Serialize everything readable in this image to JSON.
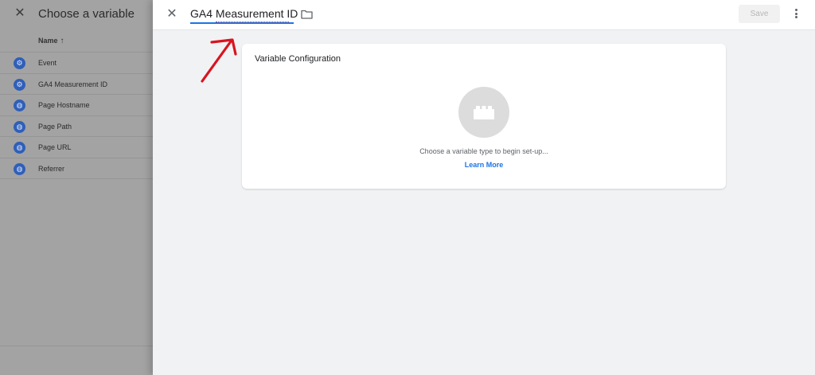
{
  "left_panel": {
    "title": "Choose a variable",
    "column_header": "Name",
    "sort_arrow": "↑",
    "variables": [
      {
        "label": "Event",
        "icon": "gear-icon"
      },
      {
        "label": "GA4 Measurement ID",
        "icon": "gear-icon"
      },
      {
        "label": "Page Hostname",
        "icon": "globe-icon"
      },
      {
        "label": "Page Path",
        "icon": "globe-icon"
      },
      {
        "label": "Page URL",
        "icon": "globe-icon"
      },
      {
        "label": "Referrer",
        "icon": "globe-icon"
      }
    ]
  },
  "editor": {
    "name": "GA4 Measurement ID",
    "save_label": "Save",
    "card": {
      "title": "Variable Configuration",
      "hint": "Choose a variable type to begin set-up...",
      "link": "Learn More"
    }
  },
  "colors": {
    "accent": "#1a73e8",
    "annotation": "#d8141f"
  }
}
